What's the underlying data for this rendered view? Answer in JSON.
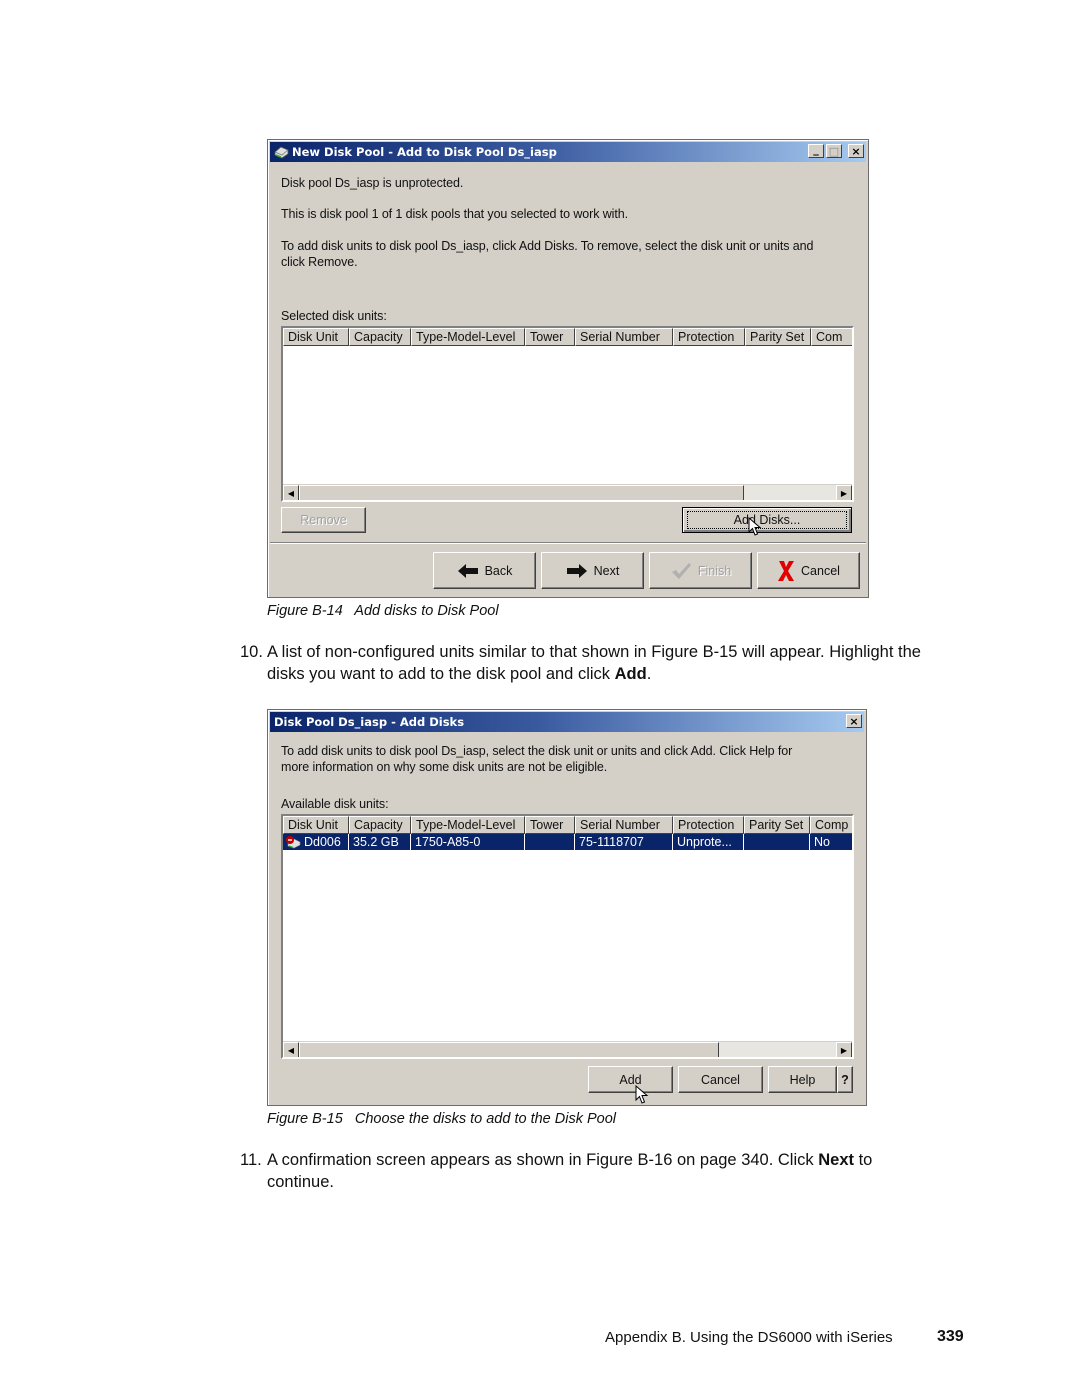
{
  "figure_b14": {
    "window": {
      "title": "New Disk Pool - Add to Disk Pool Ds_iasp",
      "title_icon": "disk-pool-icon",
      "controls": {
        "minimize": "_",
        "maximize": "□",
        "close": "×"
      },
      "message_1": "Disk pool Ds_iasp is unprotected.",
      "message_2": "This is disk pool 1 of 1 disk pools that you selected to work with.",
      "message_3_line1": "To add disk units to disk pool Ds_iasp, click Add Disks. To remove, select the disk unit or units and",
      "message_3_line2": "click Remove.",
      "table_label": "Selected disk units:",
      "columns": [
        "Disk Unit",
        "Capacity",
        "Type-Model-Level",
        "Tower",
        "Serial Number",
        "Protection",
        "Parity Set",
        "Com"
      ],
      "rows": [],
      "remove_label": "Remove",
      "remove_enabled": false,
      "add_disks_label": "Add Disks...",
      "nav": {
        "back_label": "Back",
        "back_icon": "arrow-left-icon",
        "next_label": "Next",
        "next_icon": "arrow-right-icon",
        "finish_label": "Finish",
        "finish_icon": "checkmark-icon",
        "finish_enabled": false,
        "cancel_label": "Cancel",
        "cancel_icon": "red-x-icon"
      }
    },
    "caption": "Figure B-14   Add disks to Disk Pool"
  },
  "step_10": {
    "number": "10.",
    "text_line1": "A list of non-configured units similar to that shown in Figure B-15 will appear. Highlight the",
    "text_line2_pre": "disks you want to add to the disk pool and click ",
    "text_line2_bold": "Add",
    "text_line2_post": "."
  },
  "figure_b15": {
    "window": {
      "title": "Disk Pool Ds_iasp - Add Disks",
      "controls": {
        "close": "×"
      },
      "message_line1": "To add disk units to disk pool Ds_iasp, select the disk unit or units and click Add. Click Help for",
      "message_line2": "more information on why some disk units are not be eligible.",
      "table_label": "Available disk units:",
      "columns": [
        "Disk Unit",
        "Capacity",
        "Type-Model-Level",
        "Tower",
        "Serial Number",
        "Protection",
        "Parity Set",
        "Comp"
      ],
      "rows": [
        {
          "icon": "disk-unit-icon",
          "disk_unit": "Dd006",
          "capacity": "35.2 GB",
          "type_model_level": "1750-A85-0",
          "tower": "",
          "serial_number": "75-1118707",
          "protection": "Unprote...",
          "parity_set": "",
          "comp": "No",
          "selected": true
        }
      ],
      "add_label": "Add",
      "cancel_label": "Cancel",
      "help_label": "Help",
      "help_q_label": "?"
    },
    "caption": "Figure B-15   Choose the disks to add to the Disk Pool"
  },
  "step_11": {
    "number": "11.",
    "text_line1_pre": "A confirmation screen appears as shown in Figure B-16 on page 340. Click ",
    "text_line1_bold": "Next",
    "text_line1_post": " to",
    "text_line2": "continue."
  },
  "footer": {
    "text": "Appendix B. Using the DS6000 with iSeries",
    "page_number": "339"
  },
  "colors": {
    "dialog_bg": "#d4d0c8",
    "title_gradient_start": "#0a246a",
    "title_gradient_end": "#a6caf0",
    "selection": "#0a246a",
    "cancel_x": "#e00000"
  }
}
